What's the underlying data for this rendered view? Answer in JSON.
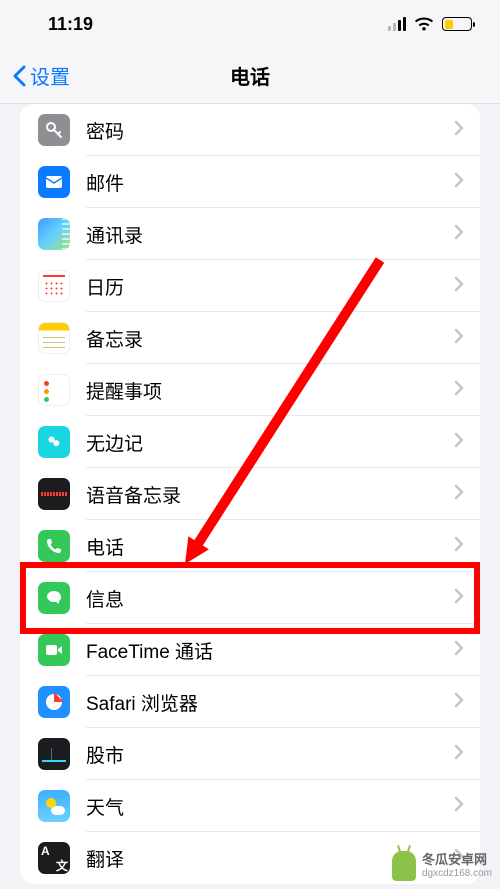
{
  "status": {
    "time": "11:19"
  },
  "nav": {
    "back_label": "设置",
    "title": "电话"
  },
  "items": [
    {
      "label": "密码",
      "icon": "key-icon"
    },
    {
      "label": "邮件",
      "icon": "mail-icon"
    },
    {
      "label": "通讯录",
      "icon": "contacts-icon"
    },
    {
      "label": "日历",
      "icon": "calendar-icon"
    },
    {
      "label": "备忘录",
      "icon": "notes-icon"
    },
    {
      "label": "提醒事项",
      "icon": "reminders-icon"
    },
    {
      "label": "无边记",
      "icon": "freeform-icon"
    },
    {
      "label": "语音备忘录",
      "icon": "voice-memos-icon"
    },
    {
      "label": "电话",
      "icon": "phone-icon"
    },
    {
      "label": "信息",
      "icon": "messages-icon"
    },
    {
      "label": "FaceTime 通话",
      "icon": "facetime-icon"
    },
    {
      "label": "Safari 浏览器",
      "icon": "safari-icon"
    },
    {
      "label": "股市",
      "icon": "stocks-icon"
    },
    {
      "label": "天气",
      "icon": "weather-icon"
    },
    {
      "label": "翻译",
      "icon": "translate-icon"
    }
  ],
  "annotation": {
    "highlight_index": 9
  },
  "watermark": {
    "name": "冬瓜安卓网",
    "url": "dgxcdz168.com"
  }
}
